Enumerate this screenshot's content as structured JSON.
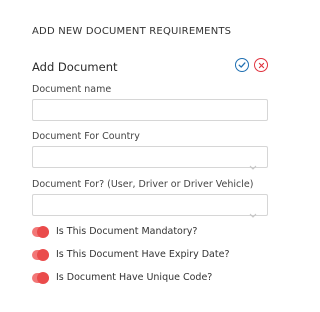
{
  "section_title": "ADD NEW DOCUMENT REQUIREMENTS",
  "card": {
    "title": "Add Document",
    "confirm_icon": "check-circle-icon",
    "cancel_icon": "close-circle-icon"
  },
  "fields": {
    "document_name": {
      "label": "Document name",
      "value": "",
      "placeholder": ""
    },
    "country": {
      "label": "Document For Country",
      "selected": ""
    },
    "document_for": {
      "label": "Document For? (User, Driver or Driver Vehicle)",
      "selected": ""
    }
  },
  "toggles": [
    {
      "label": "Is This Document Mandatory?",
      "on": true
    },
    {
      "label": "Is This Document Have Expiry Date?",
      "on": true
    },
    {
      "label": "Is Document Have Unique Code?",
      "on": true
    }
  ],
  "colors": {
    "confirm": "#1f6fb2",
    "cancel": "#e0313d",
    "toggle_track": "#f27777",
    "toggle_knob": "#ea4b4b",
    "border": "#d6d6d6"
  }
}
